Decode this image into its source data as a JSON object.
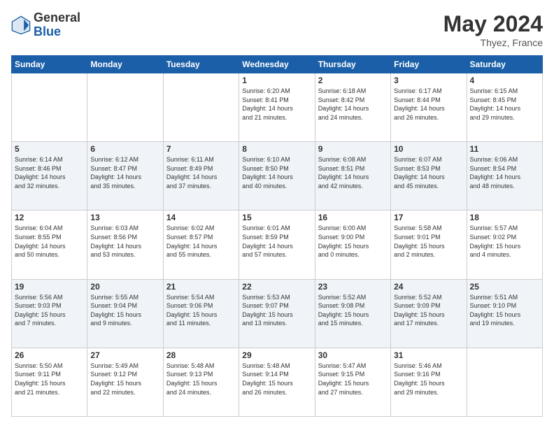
{
  "logo": {
    "general": "General",
    "blue": "Blue"
  },
  "title": "May 2024",
  "location": "Thyez, France",
  "days_of_week": [
    "Sunday",
    "Monday",
    "Tuesday",
    "Wednesday",
    "Thursday",
    "Friday",
    "Saturday"
  ],
  "weeks": [
    [
      {
        "day": "",
        "info": ""
      },
      {
        "day": "",
        "info": ""
      },
      {
        "day": "",
        "info": ""
      },
      {
        "day": "1",
        "info": "Sunrise: 6:20 AM\nSunset: 8:41 PM\nDaylight: 14 hours\nand 21 minutes."
      },
      {
        "day": "2",
        "info": "Sunrise: 6:18 AM\nSunset: 8:42 PM\nDaylight: 14 hours\nand 24 minutes."
      },
      {
        "day": "3",
        "info": "Sunrise: 6:17 AM\nSunset: 8:44 PM\nDaylight: 14 hours\nand 26 minutes."
      },
      {
        "day": "4",
        "info": "Sunrise: 6:15 AM\nSunset: 8:45 PM\nDaylight: 14 hours\nand 29 minutes."
      }
    ],
    [
      {
        "day": "5",
        "info": "Sunrise: 6:14 AM\nSunset: 8:46 PM\nDaylight: 14 hours\nand 32 minutes."
      },
      {
        "day": "6",
        "info": "Sunrise: 6:12 AM\nSunset: 8:47 PM\nDaylight: 14 hours\nand 35 minutes."
      },
      {
        "day": "7",
        "info": "Sunrise: 6:11 AM\nSunset: 8:49 PM\nDaylight: 14 hours\nand 37 minutes."
      },
      {
        "day": "8",
        "info": "Sunrise: 6:10 AM\nSunset: 8:50 PM\nDaylight: 14 hours\nand 40 minutes."
      },
      {
        "day": "9",
        "info": "Sunrise: 6:08 AM\nSunset: 8:51 PM\nDaylight: 14 hours\nand 42 minutes."
      },
      {
        "day": "10",
        "info": "Sunrise: 6:07 AM\nSunset: 8:53 PM\nDaylight: 14 hours\nand 45 minutes."
      },
      {
        "day": "11",
        "info": "Sunrise: 6:06 AM\nSunset: 8:54 PM\nDaylight: 14 hours\nand 48 minutes."
      }
    ],
    [
      {
        "day": "12",
        "info": "Sunrise: 6:04 AM\nSunset: 8:55 PM\nDaylight: 14 hours\nand 50 minutes."
      },
      {
        "day": "13",
        "info": "Sunrise: 6:03 AM\nSunset: 8:56 PM\nDaylight: 14 hours\nand 53 minutes."
      },
      {
        "day": "14",
        "info": "Sunrise: 6:02 AM\nSunset: 8:57 PM\nDaylight: 14 hours\nand 55 minutes."
      },
      {
        "day": "15",
        "info": "Sunrise: 6:01 AM\nSunset: 8:59 PM\nDaylight: 14 hours\nand 57 minutes."
      },
      {
        "day": "16",
        "info": "Sunrise: 6:00 AM\nSunset: 9:00 PM\nDaylight: 15 hours\nand 0 minutes."
      },
      {
        "day": "17",
        "info": "Sunrise: 5:58 AM\nSunset: 9:01 PM\nDaylight: 15 hours\nand 2 minutes."
      },
      {
        "day": "18",
        "info": "Sunrise: 5:57 AM\nSunset: 9:02 PM\nDaylight: 15 hours\nand 4 minutes."
      }
    ],
    [
      {
        "day": "19",
        "info": "Sunrise: 5:56 AM\nSunset: 9:03 PM\nDaylight: 15 hours\nand 7 minutes."
      },
      {
        "day": "20",
        "info": "Sunrise: 5:55 AM\nSunset: 9:04 PM\nDaylight: 15 hours\nand 9 minutes."
      },
      {
        "day": "21",
        "info": "Sunrise: 5:54 AM\nSunset: 9:06 PM\nDaylight: 15 hours\nand 11 minutes."
      },
      {
        "day": "22",
        "info": "Sunrise: 5:53 AM\nSunset: 9:07 PM\nDaylight: 15 hours\nand 13 minutes."
      },
      {
        "day": "23",
        "info": "Sunrise: 5:52 AM\nSunset: 9:08 PM\nDaylight: 15 hours\nand 15 minutes."
      },
      {
        "day": "24",
        "info": "Sunrise: 5:52 AM\nSunset: 9:09 PM\nDaylight: 15 hours\nand 17 minutes."
      },
      {
        "day": "25",
        "info": "Sunrise: 5:51 AM\nSunset: 9:10 PM\nDaylight: 15 hours\nand 19 minutes."
      }
    ],
    [
      {
        "day": "26",
        "info": "Sunrise: 5:50 AM\nSunset: 9:11 PM\nDaylight: 15 hours\nand 21 minutes."
      },
      {
        "day": "27",
        "info": "Sunrise: 5:49 AM\nSunset: 9:12 PM\nDaylight: 15 hours\nand 22 minutes."
      },
      {
        "day": "28",
        "info": "Sunrise: 5:48 AM\nSunset: 9:13 PM\nDaylight: 15 hours\nand 24 minutes."
      },
      {
        "day": "29",
        "info": "Sunrise: 5:48 AM\nSunset: 9:14 PM\nDaylight: 15 hours\nand 26 minutes."
      },
      {
        "day": "30",
        "info": "Sunrise: 5:47 AM\nSunset: 9:15 PM\nDaylight: 15 hours\nand 27 minutes."
      },
      {
        "day": "31",
        "info": "Sunrise: 5:46 AM\nSunset: 9:16 PM\nDaylight: 15 hours\nand 29 minutes."
      },
      {
        "day": "",
        "info": ""
      }
    ]
  ]
}
